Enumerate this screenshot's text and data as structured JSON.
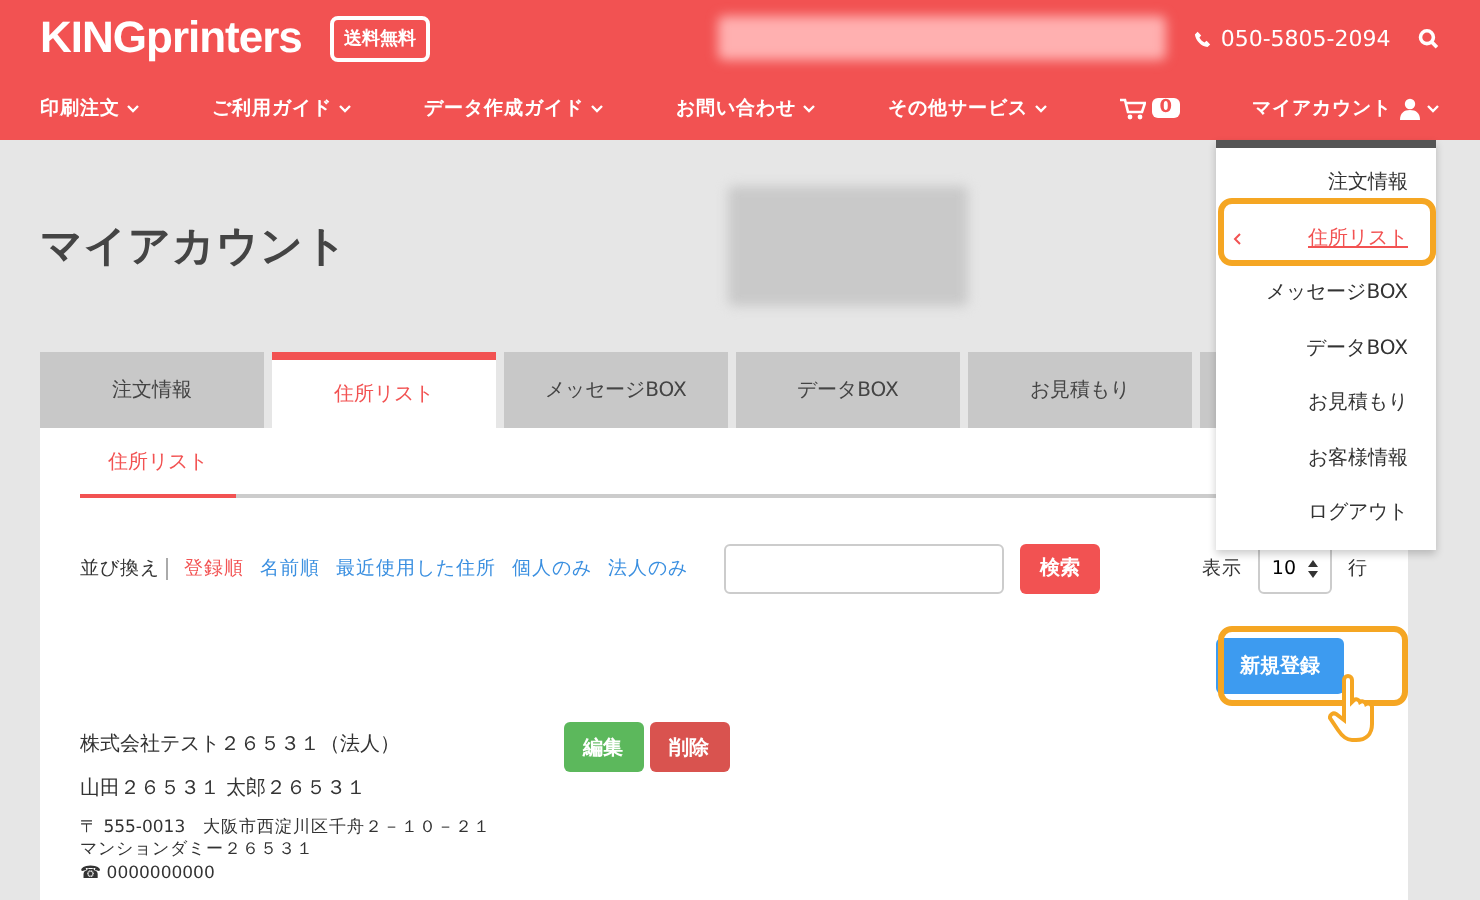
{
  "header": {
    "logo": "KINGprinters",
    "shipping_badge": "送料無料",
    "phone": "050-5805-2094"
  },
  "nav": [
    {
      "label": "印刷注文"
    },
    {
      "label": "ご利用ガイド"
    },
    {
      "label": "データ作成ガイド"
    },
    {
      "label": "お問い合わせ"
    },
    {
      "label": "その他サービス"
    }
  ],
  "cart_count": "0",
  "account_menu": {
    "label": "マイアカウント",
    "expanded": true,
    "items": [
      {
        "label": "注文情報",
        "selected": false
      },
      {
        "label": "住所リスト",
        "selected": true
      },
      {
        "label": "メッセージBOX",
        "selected": false
      },
      {
        "label": "データBOX",
        "selected": false
      },
      {
        "label": "お見積もり",
        "selected": false
      },
      {
        "label": "お客様情報",
        "selected": false
      },
      {
        "label": "ログアウト",
        "selected": false
      }
    ]
  },
  "page_title": "マイアカウント",
  "tabs": [
    {
      "label": "注文情報",
      "selected": false
    },
    {
      "label": "住所リスト",
      "selected": true
    },
    {
      "label": "メッセージBOX",
      "selected": false
    },
    {
      "label": "データBOX",
      "selected": false
    },
    {
      "label": "お見積もり",
      "selected": false
    }
  ],
  "subtabs": [
    {
      "label": "住所リスト",
      "selected": true
    }
  ],
  "sort": {
    "label": "並び換え",
    "options": [
      {
        "label": "登録順",
        "selected": true
      },
      {
        "label": "名前順",
        "selected": false
      },
      {
        "label": "最近使用した住所",
        "selected": false
      },
      {
        "label": "個人のみ",
        "selected": false
      },
      {
        "label": "法人のみ",
        "selected": false
      }
    ]
  },
  "search_button": "検索",
  "per_page": {
    "label": "表示",
    "value": "10",
    "unit": "行"
  },
  "new_button": "新規登録",
  "address": {
    "company": "株式会社テスト２６５３１（法人）",
    "name": "山田２６５３１ 太郎２６５３１",
    "postal": "〒 555-0013　大阪市西淀川区千舟２－１０－２１",
    "building": "マンションダミー２６５３１",
    "phone": "☎ 0000000000"
  },
  "row_buttons": [
    {
      "label": "編集",
      "kind": "edit"
    },
    {
      "label": "削除",
      "kind": "delete"
    }
  ]
}
